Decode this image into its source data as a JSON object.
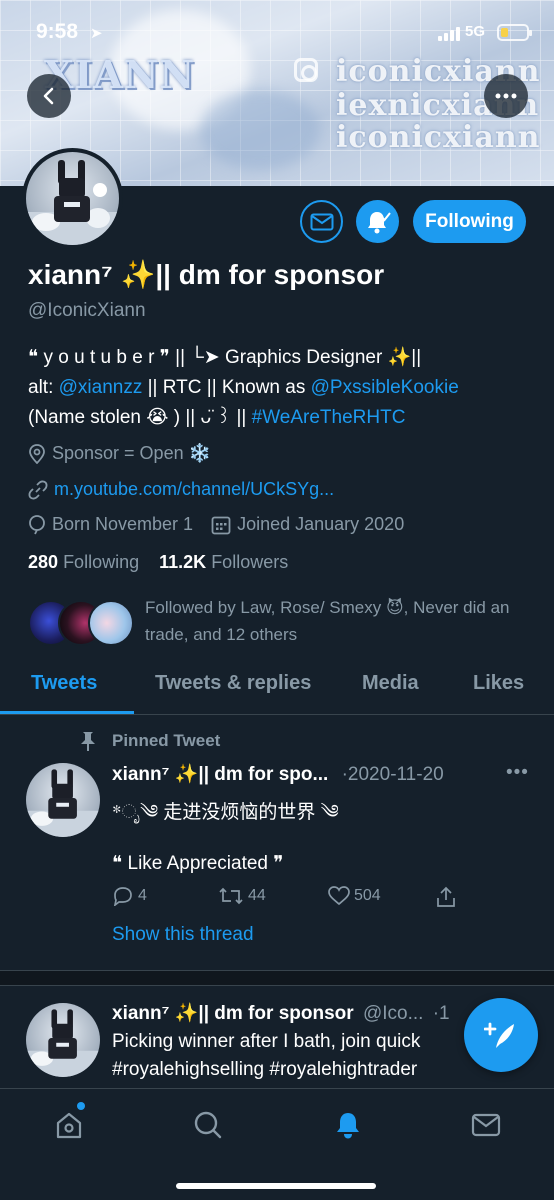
{
  "status_bar": {
    "time": "9:58",
    "network": "5G"
  },
  "banner": {
    "watermark_big": "XIANN",
    "watermark_lines": [
      "iconicxiann",
      "iexnicxiann",
      "iconicxiann"
    ]
  },
  "profile": {
    "display_name": "xiann⁷ ✨|| dm for sponsor",
    "handle": "@IconicXiann",
    "bio_line1": "❝ y o u t u b e r ❞ || └➤ Graphics Designer ✨||",
    "bio_line2_prefix": "alt: ",
    "bio_line2_link1": "@xiannzz",
    "bio_line2_middle": " || RTC || Known as ",
    "bio_line2_link2": "@PxssibleKookie",
    "bio_line3_prefix": "(Name stolen 😭 ) || ᴗ̈ ꒱ || ",
    "bio_line3_link": "#WeAreTheRHTC",
    "location": "Sponsor = Open ❄️",
    "website": "m.youtube.com/channel/UCkSYg...",
    "born": "Born November 1",
    "joined": "Joined January 2020",
    "following_count": "280",
    "following_label": "Following",
    "followers_count": "11.2K",
    "followers_label": "Followers",
    "followed_by": "Followed by Law, Rose/ Smexy 😈, Never did an trade, and 12 others"
  },
  "buttons": {
    "following": "Following"
  },
  "tabs": [
    "Tweets",
    "Tweets & replies",
    "Media",
    "Likes"
  ],
  "tweets": [
    {
      "pinned_label": "Pinned Tweet",
      "author": "xiann⁷ ✨|| dm for spo...",
      "date": "·2020-11-20",
      "line1": "*ೃ༄ 走进没烦恼的世界 ༄",
      "line2": "❝ Like Appreciated ❞",
      "replies": "4",
      "retweets": "44",
      "likes": "504",
      "show_thread": "Show this thread"
    },
    {
      "author": "xiann⁷ ✨|| dm for sponsor",
      "handle": "@Ico...",
      "date": "·1",
      "line1": "Picking winner after I bath, join quick",
      "line2": "#royalehighselling #royalehightrader"
    }
  ],
  "colors": {
    "accent": "#1d9bf0",
    "background": "#15202b",
    "secondary_text": "#8899a6"
  }
}
